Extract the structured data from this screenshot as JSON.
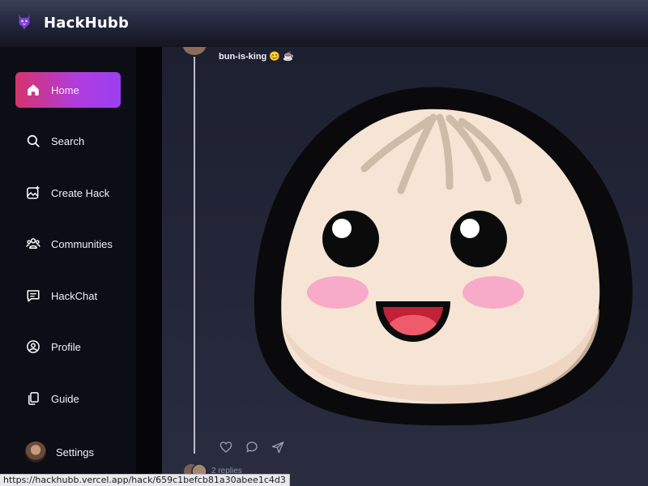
{
  "app": {
    "name": "HackHubb"
  },
  "sidebar": {
    "items": [
      {
        "label": "Home",
        "icon": "home-icon",
        "active": true
      },
      {
        "label": "Search",
        "icon": "search-icon"
      },
      {
        "label": "Create Hack",
        "icon": "image-plus-icon"
      },
      {
        "label": "Communities",
        "icon": "users-icon"
      },
      {
        "label": "HackChat",
        "icon": "chat-icon"
      },
      {
        "label": "Profile",
        "icon": "user-circle-icon"
      },
      {
        "label": "Guide",
        "icon": "copy-icon"
      },
      {
        "label": "Settings",
        "icon": "avatar"
      }
    ]
  },
  "post": {
    "username": "bun-is-king",
    "username_emoji": "😊 ☕",
    "image": "bun-mascot",
    "actions": [
      "heart-icon",
      "comment-icon",
      "send-icon"
    ],
    "replies_label": "2 replies"
  },
  "status_url": "https://hackhubb.vercel.app/hack/659c1befcb81a30abee1c4d3",
  "colors": {
    "accent_start": "#d6336c",
    "accent_end": "#9b3ff0",
    "feed_bg": "#232638",
    "sidebar_bg": "#0d0d16"
  }
}
